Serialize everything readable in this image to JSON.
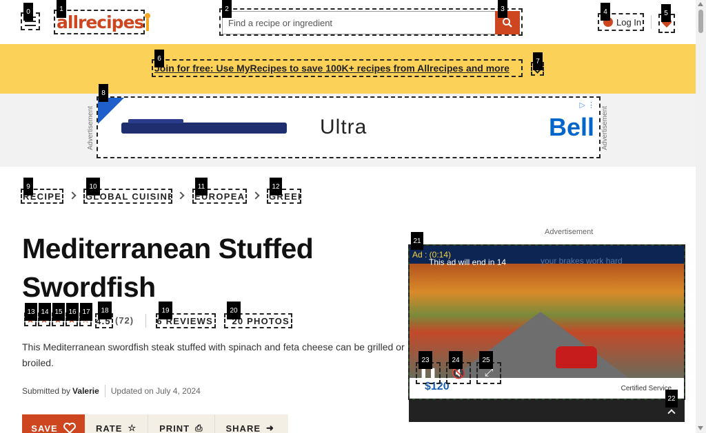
{
  "header": {
    "logo_text": "allrecipes",
    "search_placeholder": "Find a recipe or ingredient",
    "login_label": "Log In"
  },
  "promo": {
    "text": "Join for free: Use MyRecipes to save 100K+ recipes from Allrecipes and more"
  },
  "top_ad": {
    "label": "Advertisement",
    "product_text": "Ultra",
    "brand_text": "Bell"
  },
  "breadcrumbs": [
    "RECIPES",
    "GLOBAL CUISINES",
    "EUROPEAN",
    "GREEK"
  ],
  "recipe": {
    "title": "Mediterranean Stuffed Swordfish",
    "rating_count": "(72)",
    "reviews_link": "56 REVIEWS",
    "photos_link": "20 PHOTOS",
    "description": "This Mediterranean swordfish steak stuffed with spinach and feta cheese can be grilled or broiled.",
    "submitted_prefix": "Submitted by",
    "author": "Valerie",
    "updated": "Updated on July 4, 2024",
    "rating_stars": 4.5
  },
  "actions": {
    "save": "SAVE",
    "rate": "RATE",
    "print": "PRINT",
    "share": "SHARE"
  },
  "side_ad": {
    "label": "Advertisement",
    "timer": "Ad : (0:14)",
    "countdown": "This ad will end in 14",
    "tagline": "your brakes work hard",
    "offer_text": "$120",
    "service_text": "Certified Service"
  },
  "markers": [
    "0",
    "1",
    "2",
    "3",
    "4",
    "5",
    "6",
    "7",
    "8",
    "9",
    "10",
    "11",
    "12",
    "13",
    "14",
    "15",
    "16",
    "17",
    "18",
    "19",
    "20",
    "21",
    "22",
    "23",
    "24",
    "25"
  ],
  "colors": {
    "brand": "#ce4620",
    "promo_bg": "#fcd157",
    "star": "#ce4620"
  }
}
